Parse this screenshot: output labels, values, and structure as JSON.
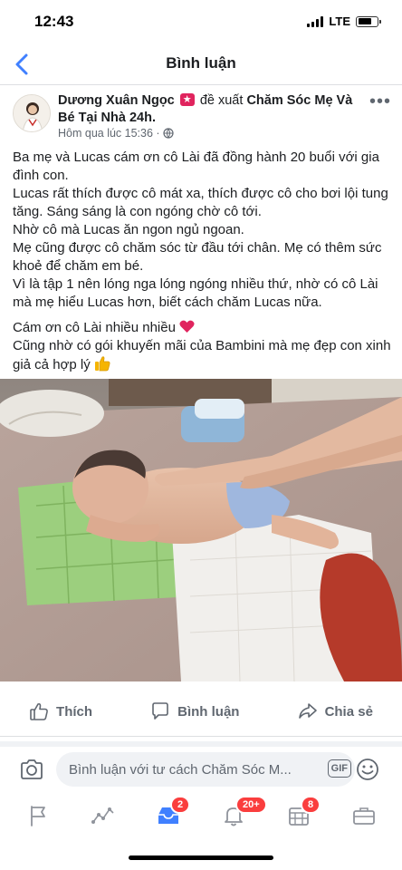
{
  "status_bar": {
    "time": "12:43",
    "network": "LTE",
    "battery_level": 0.7
  },
  "nav": {
    "title": "Bình luận"
  },
  "post": {
    "author": "Dương Xuân Ngọc",
    "verb": "đề xuất",
    "page": "Chăm Sóc Mẹ Và Bé Tại Nhà 24h",
    "timestamp": "Hôm qua lúc 15:36 ·",
    "paragraphs": [
      "Ba mẹ và Lucas cám ơn cô Lài đã đồng hành 20 buổi với gia đình con.",
      "Lucas rất thích được cô mát xa, thích được cô cho bơi lội tung tăng. Sáng sáng là con ngóng chờ cô tới.",
      "Nhờ cô mà Lucas ăn ngon ngủ ngoan.",
      "Mẹ cũng được cô chăm sóc từ đầu tới chân. Mẹ có thêm sức khoẻ để chăm em bé.",
      "Vì là tập 1 nên lóng nga lóng ngóng nhiều thứ, nhờ có cô Lài mà mẹ hiểu Lucas hơn, biết cách chăm Lucas nữa."
    ],
    "thanks": "Cám ơn cô Lài nhiều nhiều",
    "closing": "Cũng nhờ có gói khuyến mãi của Bambini mà mẹ đẹp con xinh giả cả hợp lý"
  },
  "actions": {
    "like": "Thích",
    "comment": "Bình luận",
    "share": "Chia sẻ"
  },
  "comment_bar": {
    "placeholder": "Bình luận với tư cách Chăm Sóc M...",
    "gif": "GIF"
  },
  "tab_bar": {
    "badges": {
      "inbox": "2",
      "notifications": "20+",
      "calendar": "8"
    }
  },
  "colors": {
    "accent": "#4080ff",
    "badge": "#fa3e3e",
    "heart": "#e0245e",
    "thumb": "#f5b400"
  }
}
